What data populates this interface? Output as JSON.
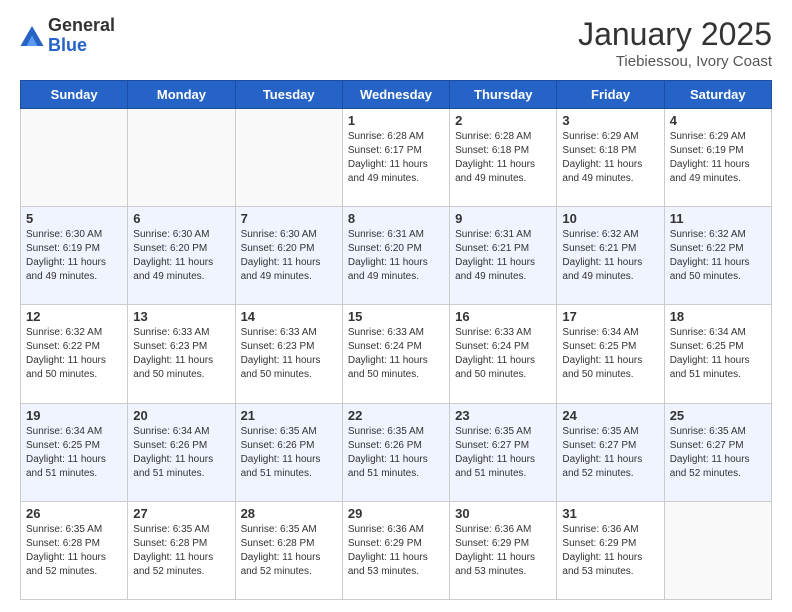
{
  "logo": {
    "general": "General",
    "blue": "Blue"
  },
  "header": {
    "month": "January 2025",
    "location": "Tiebiessou, Ivory Coast"
  },
  "weekdays": [
    "Sunday",
    "Monday",
    "Tuesday",
    "Wednesday",
    "Thursday",
    "Friday",
    "Saturday"
  ],
  "weeks": [
    [
      {
        "day": "",
        "info": ""
      },
      {
        "day": "",
        "info": ""
      },
      {
        "day": "",
        "info": ""
      },
      {
        "day": "1",
        "info": "Sunrise: 6:28 AM\nSunset: 6:17 PM\nDaylight: 11 hours\nand 49 minutes."
      },
      {
        "day": "2",
        "info": "Sunrise: 6:28 AM\nSunset: 6:18 PM\nDaylight: 11 hours\nand 49 minutes."
      },
      {
        "day": "3",
        "info": "Sunrise: 6:29 AM\nSunset: 6:18 PM\nDaylight: 11 hours\nand 49 minutes."
      },
      {
        "day": "4",
        "info": "Sunrise: 6:29 AM\nSunset: 6:19 PM\nDaylight: 11 hours\nand 49 minutes."
      }
    ],
    [
      {
        "day": "5",
        "info": "Sunrise: 6:30 AM\nSunset: 6:19 PM\nDaylight: 11 hours\nand 49 minutes."
      },
      {
        "day": "6",
        "info": "Sunrise: 6:30 AM\nSunset: 6:20 PM\nDaylight: 11 hours\nand 49 minutes."
      },
      {
        "day": "7",
        "info": "Sunrise: 6:30 AM\nSunset: 6:20 PM\nDaylight: 11 hours\nand 49 minutes."
      },
      {
        "day": "8",
        "info": "Sunrise: 6:31 AM\nSunset: 6:20 PM\nDaylight: 11 hours\nand 49 minutes."
      },
      {
        "day": "9",
        "info": "Sunrise: 6:31 AM\nSunset: 6:21 PM\nDaylight: 11 hours\nand 49 minutes."
      },
      {
        "day": "10",
        "info": "Sunrise: 6:32 AM\nSunset: 6:21 PM\nDaylight: 11 hours\nand 49 minutes."
      },
      {
        "day": "11",
        "info": "Sunrise: 6:32 AM\nSunset: 6:22 PM\nDaylight: 11 hours\nand 50 minutes."
      }
    ],
    [
      {
        "day": "12",
        "info": "Sunrise: 6:32 AM\nSunset: 6:22 PM\nDaylight: 11 hours\nand 50 minutes."
      },
      {
        "day": "13",
        "info": "Sunrise: 6:33 AM\nSunset: 6:23 PM\nDaylight: 11 hours\nand 50 minutes."
      },
      {
        "day": "14",
        "info": "Sunrise: 6:33 AM\nSunset: 6:23 PM\nDaylight: 11 hours\nand 50 minutes."
      },
      {
        "day": "15",
        "info": "Sunrise: 6:33 AM\nSunset: 6:24 PM\nDaylight: 11 hours\nand 50 minutes."
      },
      {
        "day": "16",
        "info": "Sunrise: 6:33 AM\nSunset: 6:24 PM\nDaylight: 11 hours\nand 50 minutes."
      },
      {
        "day": "17",
        "info": "Sunrise: 6:34 AM\nSunset: 6:25 PM\nDaylight: 11 hours\nand 50 minutes."
      },
      {
        "day": "18",
        "info": "Sunrise: 6:34 AM\nSunset: 6:25 PM\nDaylight: 11 hours\nand 51 minutes."
      }
    ],
    [
      {
        "day": "19",
        "info": "Sunrise: 6:34 AM\nSunset: 6:25 PM\nDaylight: 11 hours\nand 51 minutes."
      },
      {
        "day": "20",
        "info": "Sunrise: 6:34 AM\nSunset: 6:26 PM\nDaylight: 11 hours\nand 51 minutes."
      },
      {
        "day": "21",
        "info": "Sunrise: 6:35 AM\nSunset: 6:26 PM\nDaylight: 11 hours\nand 51 minutes."
      },
      {
        "day": "22",
        "info": "Sunrise: 6:35 AM\nSunset: 6:26 PM\nDaylight: 11 hours\nand 51 minutes."
      },
      {
        "day": "23",
        "info": "Sunrise: 6:35 AM\nSunset: 6:27 PM\nDaylight: 11 hours\nand 51 minutes."
      },
      {
        "day": "24",
        "info": "Sunrise: 6:35 AM\nSunset: 6:27 PM\nDaylight: 11 hours\nand 52 minutes."
      },
      {
        "day": "25",
        "info": "Sunrise: 6:35 AM\nSunset: 6:27 PM\nDaylight: 11 hours\nand 52 minutes."
      }
    ],
    [
      {
        "day": "26",
        "info": "Sunrise: 6:35 AM\nSunset: 6:28 PM\nDaylight: 11 hours\nand 52 minutes."
      },
      {
        "day": "27",
        "info": "Sunrise: 6:35 AM\nSunset: 6:28 PM\nDaylight: 11 hours\nand 52 minutes."
      },
      {
        "day": "28",
        "info": "Sunrise: 6:35 AM\nSunset: 6:28 PM\nDaylight: 11 hours\nand 52 minutes."
      },
      {
        "day": "29",
        "info": "Sunrise: 6:36 AM\nSunset: 6:29 PM\nDaylight: 11 hours\nand 53 minutes."
      },
      {
        "day": "30",
        "info": "Sunrise: 6:36 AM\nSunset: 6:29 PM\nDaylight: 11 hours\nand 53 minutes."
      },
      {
        "day": "31",
        "info": "Sunrise: 6:36 AM\nSunset: 6:29 PM\nDaylight: 11 hours\nand 53 minutes."
      },
      {
        "day": "",
        "info": ""
      }
    ]
  ]
}
